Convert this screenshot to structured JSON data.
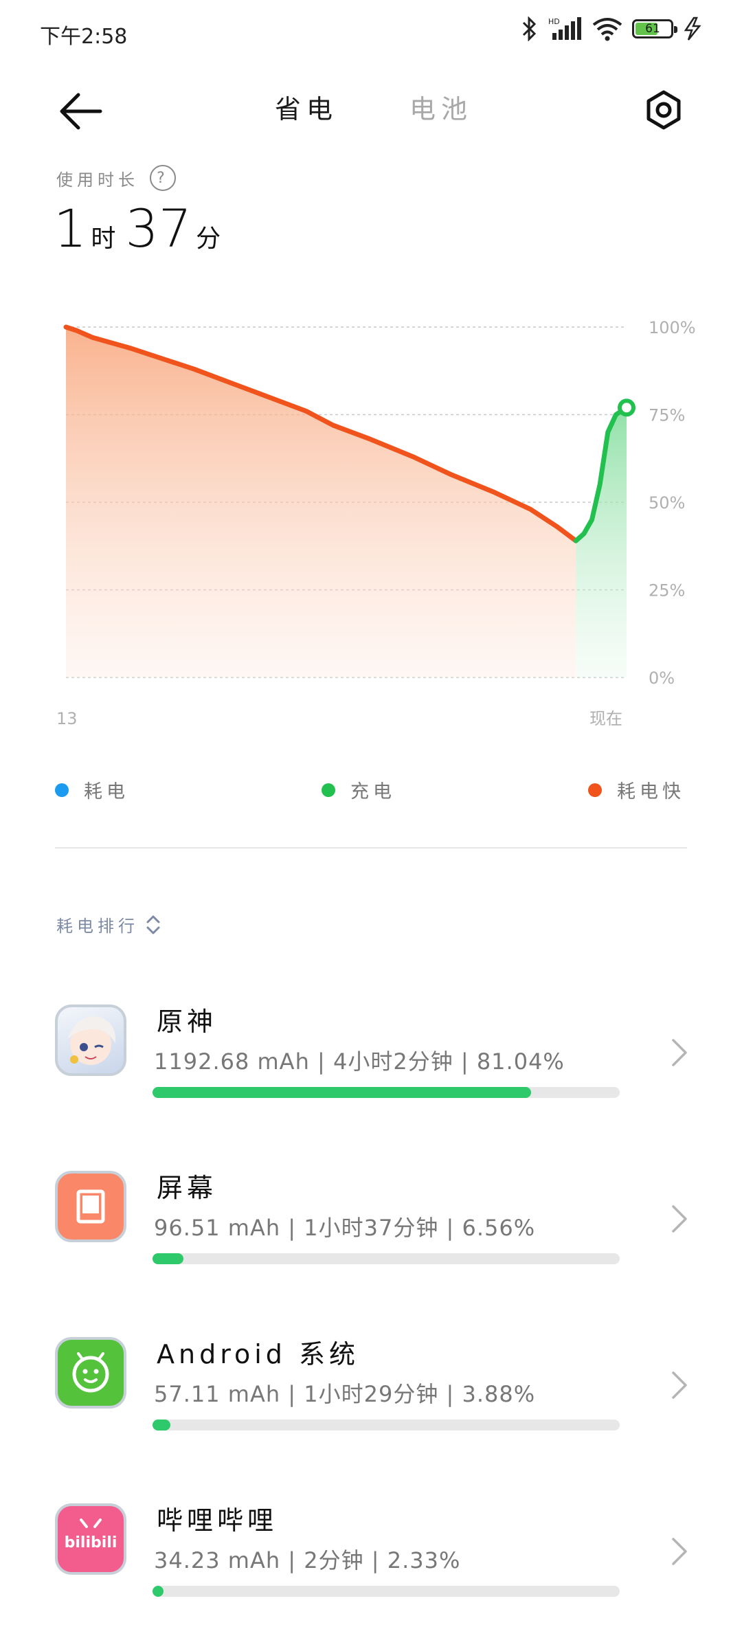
{
  "status_bar": {
    "time": "下午2:58",
    "battery": "61",
    "battery_level": 0.61
  },
  "header": {
    "tabs": [
      "省电",
      "电池"
    ],
    "active_tab": "省电"
  },
  "usage": {
    "label": "使用时长",
    "help": "?",
    "hours": "1",
    "hours_unit": "时",
    "minutes": "37",
    "minutes_unit": "分"
  },
  "chart_data": {
    "type": "line",
    "ylabels": [
      "100%",
      "75%",
      "50%",
      "25%",
      "0%"
    ],
    "xlabels": [
      "13",
      "现在"
    ],
    "ylim": [
      0,
      100
    ],
    "series": [
      {
        "name": "耗电快",
        "color": "#f0531c",
        "x": [
          0,
          0.02,
          0.05,
          0.12,
          0.18,
          0.24,
          0.31,
          0.38,
          0.45,
          0.5,
          0.57,
          0.65,
          0.72,
          0.8,
          0.87,
          0.92,
          0.955
        ],
        "values": [
          100,
          99,
          97,
          94,
          91,
          88,
          84,
          80,
          76,
          72,
          68,
          63,
          58,
          53,
          48,
          43,
          39
        ]
      },
      {
        "name": "充电",
        "color": "#22c04e",
        "x": [
          0.955,
          0.97,
          0.985,
          1.0,
          1.015,
          1.03,
          1.05
        ],
        "values": [
          39,
          41,
          45,
          55,
          70,
          75,
          77
        ]
      }
    ]
  },
  "legend": [
    {
      "label": "耗电",
      "color": "#1a9bf0"
    },
    {
      "label": "充电",
      "color": "#22c04e"
    },
    {
      "label": "耗电快",
      "color": "#f0531c"
    }
  ],
  "ranking": {
    "label": "耗电排行"
  },
  "apps": [
    {
      "name": "原神",
      "stats": "1192.68 mAh | 4小时2分钟 | 81.04%",
      "share": 0.8104,
      "icon": "genshin-icon"
    },
    {
      "name": "屏幕",
      "stats": "96.51 mAh | 1小时37分钟 | 6.56%",
      "share": 0.0656,
      "icon": "screen-icon"
    },
    {
      "name": "Android 系统",
      "stats": "57.11 mAh | 1小时29分钟 | 3.88%",
      "share": 0.0388,
      "icon": "android-icon"
    },
    {
      "name": "哔哩哔哩",
      "stats": "34.23 mAh | 2分钟 | 2.33%",
      "share": 0.0233,
      "icon": "bilibili-icon",
      "icon_text": "bilibili"
    }
  ]
}
